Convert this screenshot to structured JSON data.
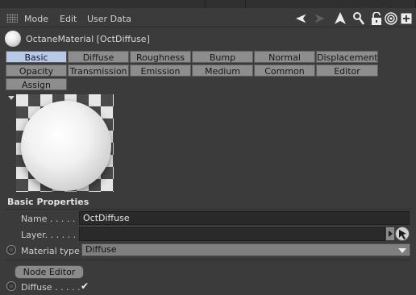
{
  "menubar": {
    "items": [
      "Mode",
      "Edit",
      "User Data"
    ],
    "icons": [
      "back-arrow-icon",
      "forward-arrow-icon",
      "up-arrow-icon",
      "search-icon",
      "lock-icon",
      "target-icon",
      "new-panel-icon"
    ]
  },
  "material": {
    "title": "OctaneMaterial [OctDiffuse]"
  },
  "tabs": {
    "row1": [
      "Basic",
      "Diffuse",
      "Roughness",
      "Bump",
      "Normal",
      "Displacement"
    ],
    "row2": [
      "Opacity",
      "Transmission",
      "Emission",
      "Medium",
      "Common",
      "Editor"
    ],
    "row3": [
      "Assign"
    ],
    "active": "Basic"
  },
  "basic_properties": {
    "header": "Basic Properties",
    "name_label": "Name . . . . . .",
    "name_value": "OctDiffuse",
    "layer_label": "Layer. . . . . . .",
    "layer_value": "",
    "material_type_label": "Material type",
    "material_type_value": "Diffuse"
  },
  "node_editor": {
    "button_label": "Node Editor",
    "diffuse_label": "Diffuse . . . . .",
    "diffuse_checked": "✔"
  },
  "colors": {
    "background": "#3b3b3b",
    "tab_active": "#b7c9e6",
    "tab": "#8d8d8d"
  }
}
